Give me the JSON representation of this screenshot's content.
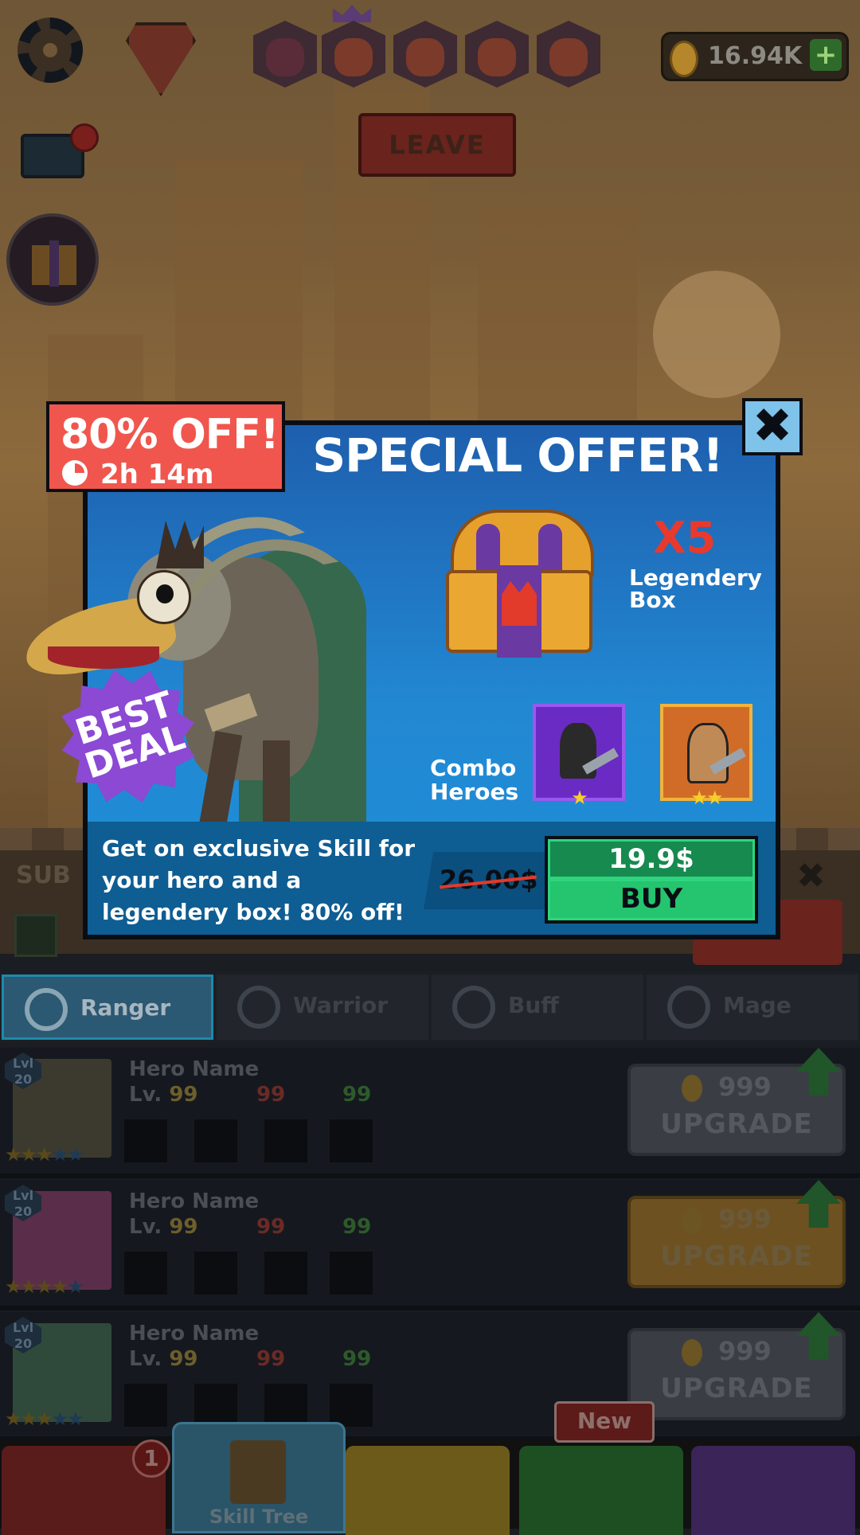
{
  "hud": {
    "coins": "16.94K",
    "plus_icon": "plus-icon",
    "leave_label": "LEAVE"
  },
  "background": {
    "sub_label": "SUB",
    "tabs": [
      {
        "label": "Ranger",
        "active": true
      },
      {
        "label": "Warrior",
        "active": false
      },
      {
        "label": "Buff",
        "active": false
      },
      {
        "label": "Mage",
        "active": false
      }
    ],
    "heroes": [
      {
        "lvl": "Lvl 20",
        "name": "Hero Name",
        "lv_label": "Lv.",
        "level": "99",
        "attack": "99",
        "health": "99",
        "cost": "999",
        "button": "UPGRADE",
        "gold": false
      },
      {
        "lvl": "Lvl 20",
        "name": "Hero Name",
        "lv_label": "Lv.",
        "level": "99",
        "attack": "99",
        "health": "99",
        "cost": "999",
        "button": "UPGRADE",
        "gold": true
      },
      {
        "lvl": "Lvl 20",
        "name": "Hero Name",
        "lv_label": "Lv.",
        "level": "99",
        "attack": "99",
        "health": "99",
        "cost": "999",
        "button": "UPGRADE",
        "gold": false
      }
    ],
    "nav": {
      "badge_count": "1",
      "new_label": "New",
      "skill_tree_label": "Skill Tree"
    }
  },
  "offer": {
    "discount": "80% OFF!",
    "timer": "2h 14m",
    "title": "SPECIAL OFFER!",
    "best_deal_line1": "BEST",
    "best_deal_line2": "DEAL",
    "multiplier": "X5",
    "box_line1": "Legendery",
    "box_line2": "Box",
    "combo_line1": "Combo",
    "combo_line2": "Heroes",
    "description": "Get on exclusive Skill for your hero and a legendery box! 80% off!",
    "old_price": "26.00$",
    "new_price": "19.9$",
    "buy_label": "BUY",
    "hero_cards": [
      {
        "stars": "★",
        "color": "purple"
      },
      {
        "stars": "★★",
        "color": "orange"
      }
    ]
  },
  "colors": {
    "popup_blue": "#1e6fbe",
    "banner_red": "#f0564d",
    "buy_green": "#25c46f",
    "x5_red": "#e73a2e"
  }
}
